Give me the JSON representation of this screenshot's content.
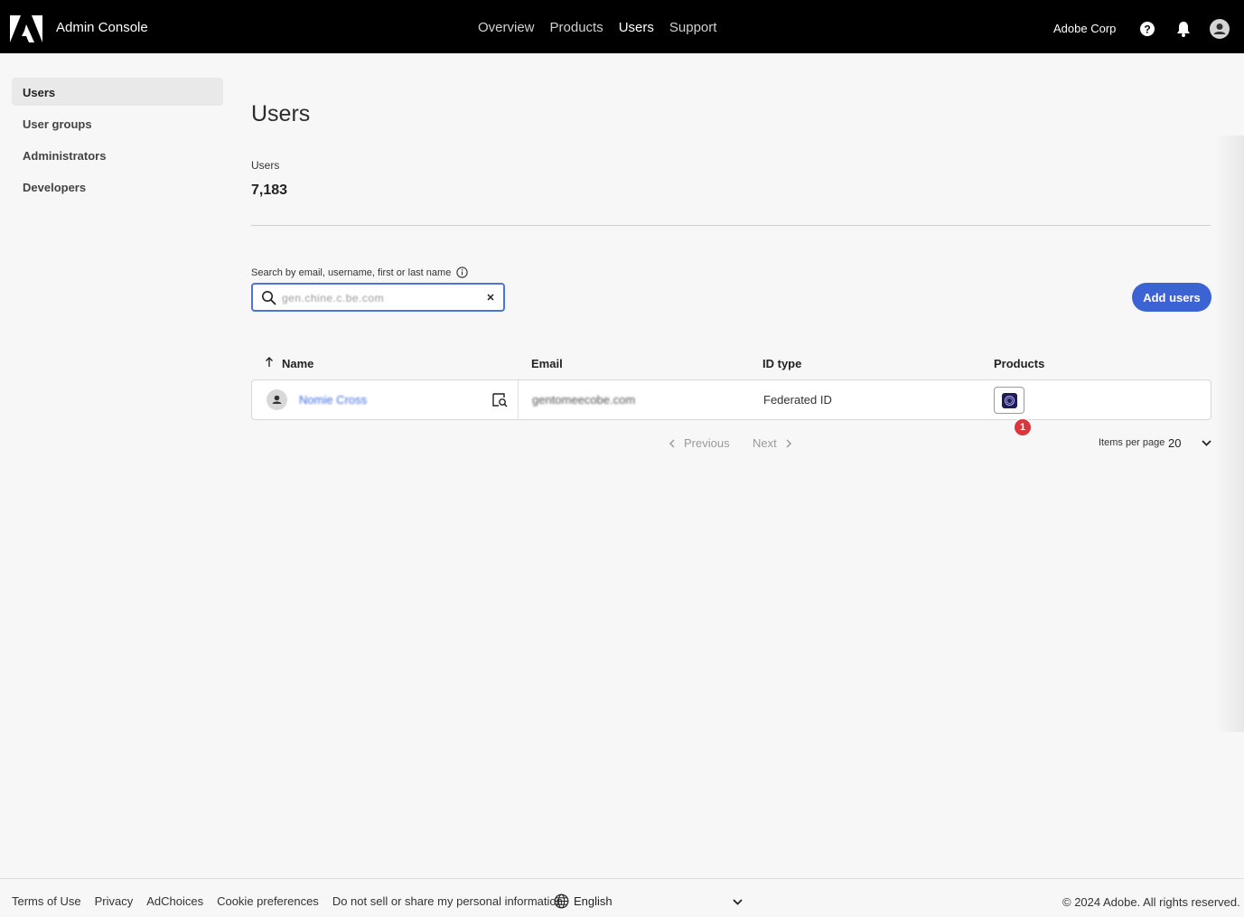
{
  "header": {
    "app_title": "Admin Console",
    "nav": [
      {
        "label": "Overview",
        "active": false
      },
      {
        "label": "Products",
        "active": false
      },
      {
        "label": "Users",
        "active": true
      },
      {
        "label": "Support",
        "active": false
      }
    ],
    "org_name": "Adobe Corp",
    "icons": [
      "adobe-logo",
      "help-icon",
      "bell-icon",
      "avatar-icon"
    ]
  },
  "sidebar": {
    "items": [
      {
        "label": "Users",
        "active": true
      },
      {
        "label": "User groups",
        "active": false
      },
      {
        "label": "Administrators",
        "active": false
      },
      {
        "label": "Developers",
        "active": false
      }
    ]
  },
  "main": {
    "title": "Users",
    "stat_label": "Users",
    "stat_value": "7,183",
    "search": {
      "label": "Search by email, username, first or last name",
      "value": "gen.chine.c.be.com"
    },
    "add_users_label": "Add users"
  },
  "table": {
    "columns": {
      "name": "Name",
      "email": "Email",
      "id_type": "ID type",
      "products": "Products"
    },
    "rows": [
      {
        "name": "Nomie Cross",
        "email": "gentomeecobe.com",
        "id_type": "Federated ID",
        "product_count": "1"
      }
    ]
  },
  "pagination": {
    "previous": "Previous",
    "next": "Next",
    "items_per_page_label": "Items per page",
    "items_per_page_value": "20"
  },
  "footer": {
    "links": [
      "Terms of Use",
      "Privacy",
      "AdChoices",
      "Cookie preferences",
      "Do not sell or share my personal information"
    ],
    "language": "English",
    "copyright": "© 2024 Adobe. All rights reserved."
  },
  "colors": {
    "accent": "#3b63d3",
    "link": "#3d6be0",
    "badge": "#d9363e",
    "topbar": "#000000"
  }
}
